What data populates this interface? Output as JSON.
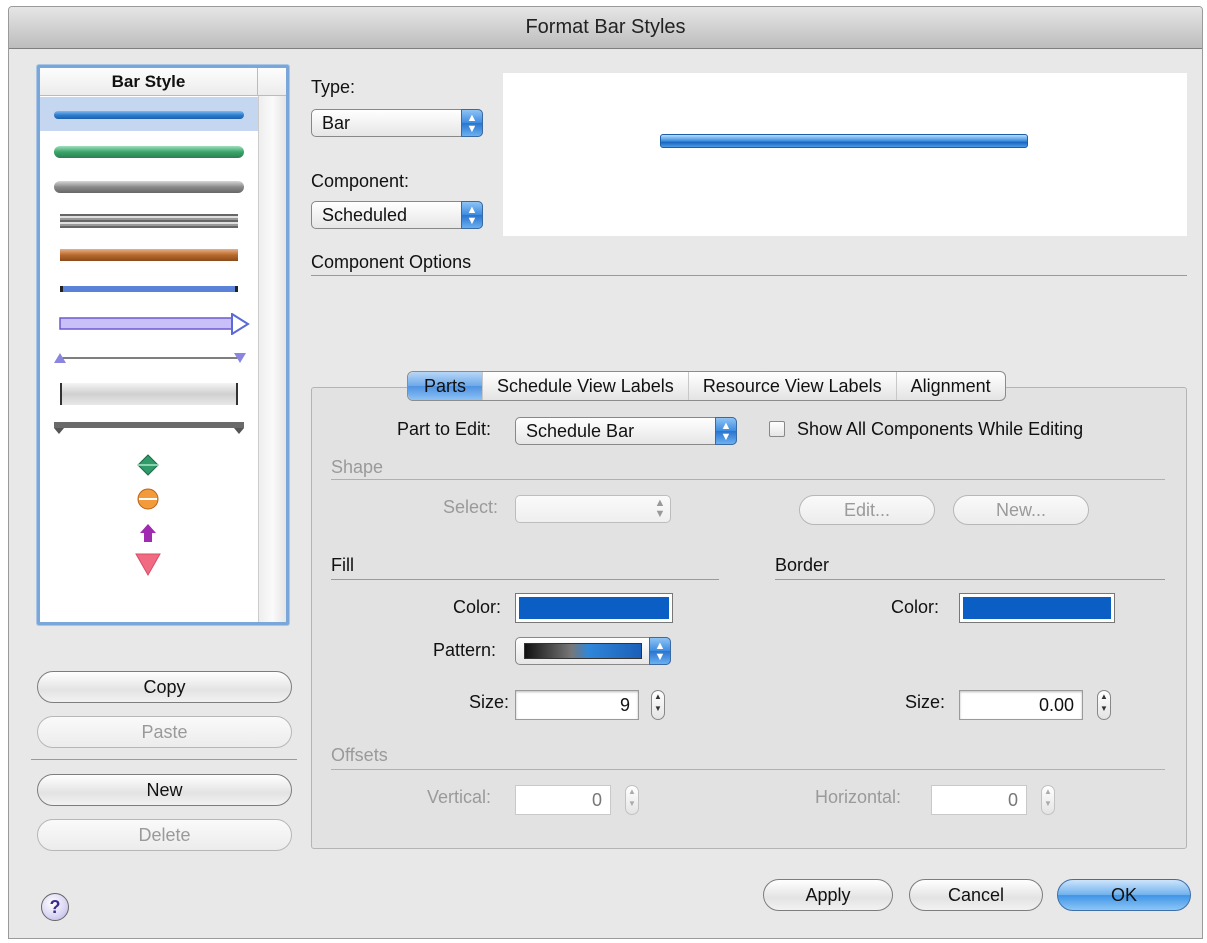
{
  "window": {
    "title": "Format Bar Styles"
  },
  "bar_style_list": {
    "header": "Bar Style",
    "items": [
      {
        "name": "blue-rounded-bar",
        "color": "#2f7fcf"
      },
      {
        "name": "green-rounded-bar",
        "color": "#3aa46a"
      },
      {
        "name": "gray-rounded-bar",
        "color": "#8a8a8a"
      },
      {
        "name": "gray-striped-bar",
        "color": "#9a9a9a"
      },
      {
        "name": "orange-bar",
        "color": "#b86a2c"
      },
      {
        "name": "blue-bracket-bar",
        "color": "#5a82d9"
      },
      {
        "name": "purple-arrow-bar",
        "color": "#9b8cf0"
      },
      {
        "name": "triangle-line-bar",
        "color": "#6a6ac8"
      },
      {
        "name": "light-bracket-bar",
        "color": "#d0d0d0"
      },
      {
        "name": "summary-bar",
        "color": "#6a6a6a"
      },
      {
        "name": "green-diamond",
        "color": "#2f9a6a"
      },
      {
        "name": "orange-circle",
        "color": "#f39a3a"
      },
      {
        "name": "purple-arrow-up",
        "color": "#a02ab0"
      },
      {
        "name": "pink-triangle-down",
        "color": "#f06a82"
      }
    ]
  },
  "buttons": {
    "copy": "Copy",
    "paste": "Paste",
    "new": "New",
    "delete": "Delete",
    "apply": "Apply",
    "cancel": "Cancel",
    "ok": "OK",
    "help": "?"
  },
  "type": {
    "label": "Type:",
    "value": "Bar"
  },
  "component": {
    "label": "Component:",
    "value": "Scheduled"
  },
  "component_options_label": "Component Options",
  "tabs": [
    "Parts",
    "Schedule View Labels",
    "Resource View Labels",
    "Alignment"
  ],
  "parts": {
    "part_to_edit_label": "Part to Edit:",
    "part_to_edit_value": "Schedule Bar",
    "show_all_label": "Show All Components While Editing",
    "shape": {
      "heading": "Shape",
      "select_label": "Select:",
      "select_value": "",
      "edit_button": "Edit...",
      "new_button": "New..."
    },
    "fill": {
      "heading": "Fill",
      "color_label": "Color:",
      "color": "#0a5ec4",
      "pattern_label": "Pattern:",
      "size_label": "Size:",
      "size_value": "9"
    },
    "border": {
      "heading": "Border",
      "color_label": "Color:",
      "color": "#0a5ec4",
      "size_label": "Size:",
      "size_value": "0.00"
    },
    "offsets": {
      "heading": "Offsets",
      "vertical_label": "Vertical:",
      "vertical_value": "0",
      "horizontal_label": "Horizontal:",
      "horizontal_value": "0"
    }
  }
}
